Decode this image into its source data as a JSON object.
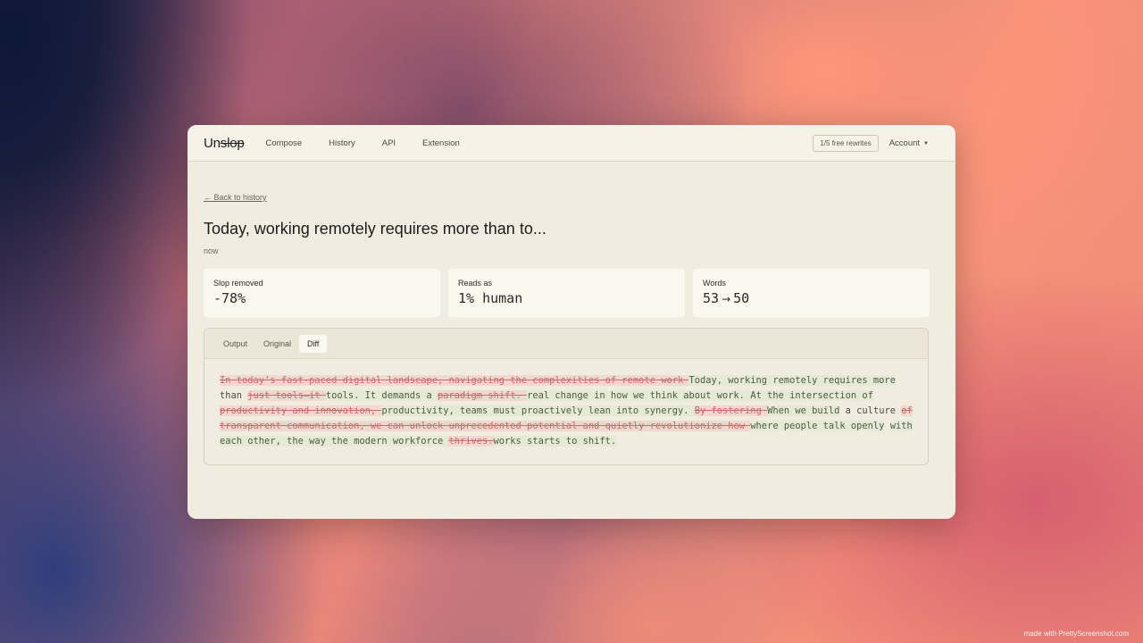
{
  "nav": {
    "logo_plain": "Un",
    "logo_struck": "slop",
    "links": [
      "Compose",
      "History",
      "API",
      "Extension"
    ],
    "free_rewrites": "1/5 free rewrites",
    "account": "Account",
    "account_caret": "▼"
  },
  "page": {
    "back_link": "← Back to history",
    "title": "Today, working remotely requires more than to...",
    "timestamp": "now"
  },
  "stats": [
    {
      "label": "Slop removed",
      "value": "-78%"
    },
    {
      "label": "Reads as",
      "value": "1% human"
    },
    {
      "label": "Words",
      "from": "53",
      "arrow": "→",
      "to": "50"
    }
  ],
  "tabs": [
    {
      "label": "Output",
      "active": false
    },
    {
      "label": "Original",
      "active": false
    },
    {
      "label": "Diff",
      "active": true
    }
  ],
  "diff": [
    {
      "type": "del",
      "text": "In today’s fast-paced digital landscape, navigating the complexities of remote work "
    },
    {
      "type": "ins",
      "text": "Today, working remotely requires more"
    },
    {
      "type": "eq",
      "text": " than "
    },
    {
      "type": "del",
      "text": "just tools—it "
    },
    {
      "type": "ins",
      "text": "tools. It demands a "
    },
    {
      "type": "del",
      "text": "paradigm shift. "
    },
    {
      "type": "ins",
      "text": "real change in how we think about work. At the intersection of "
    },
    {
      "type": "del",
      "text": "productivity and innovation, "
    },
    {
      "type": "ins",
      "text": "productivity, teams must proactively lean into synergy. "
    },
    {
      "type": "del",
      "text": "By fostering "
    },
    {
      "type": "ins",
      "text": "When we build"
    },
    {
      "type": "eq",
      "text": " a culture "
    },
    {
      "type": "del",
      "text": "of transparent communication, we can unlock unprecedented potential and quietly revolutionize how "
    },
    {
      "type": "ins",
      "text": "where people talk openly"
    },
    {
      "type": "eq",
      "text": " "
    },
    {
      "type": "ins",
      "text": "with each other, the way the modern workforce "
    },
    {
      "type": "del",
      "text": "thrives."
    },
    {
      "type": "ins",
      "text": "works starts to shift."
    }
  ],
  "watermark": "made with PrettyScreenshot.com"
}
